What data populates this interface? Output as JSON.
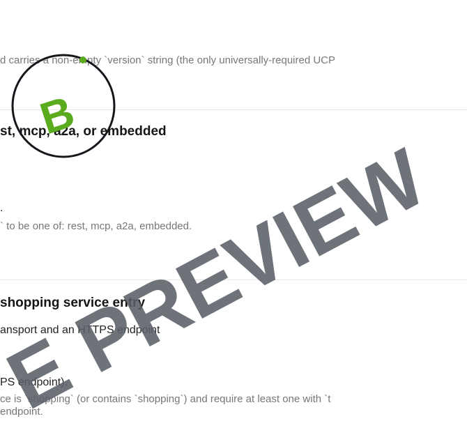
{
  "section1": {
    "desc": "d carries a non-empty `version` string (the only universally-required UCP"
  },
  "section2": {
    "heading": "st, mcp, a2a, or embedded",
    "body_tail": ".",
    "desc": "` to be one of: rest, mcp, a2a, embedded."
  },
  "section3": {
    "heading": "shopping service entry",
    "subheading": "ansport and an HTTPS endpoint",
    "body": "PS endpoint).",
    "desc_line1": "ce is `shopping` (or contains `shopping`) and require at least one with `t",
    "desc_line2": "endpoint."
  },
  "overlay": {
    "badge_letter": "B",
    "watermark": "E PREVIEW",
    "badge_color": "#5aab1e",
    "watermark_color": "#5a5e66",
    "circle_color": "#15171c"
  }
}
